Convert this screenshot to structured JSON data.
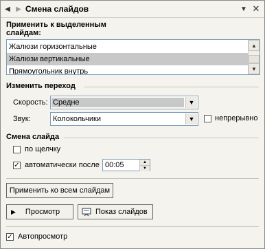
{
  "titlebar": {
    "title": "Смена слайдов",
    "back_icon": "back-arrow-icon",
    "forward_icon": "forward-arrow-icon",
    "dropdown_icon": "chevron-down-icon",
    "close_icon": "close-icon"
  },
  "apply_section": {
    "label_line1": "Применить к выделенным",
    "label_line2": "слайдам:",
    "items": [
      {
        "label": "Жалюзи горизонтальные",
        "selected": false
      },
      {
        "label": "Жалюзи вертикальные",
        "selected": true
      },
      {
        "label": "Прямоугольник внутрь",
        "selected": false
      }
    ]
  },
  "modify_section": {
    "title": "Изменить переход",
    "speed_label": "Скорость:",
    "speed_value": "Средне",
    "sound_label": "Звук:",
    "sound_value": "Колокольчики",
    "loop_label": "непрерывно",
    "loop_checked": false
  },
  "advance_section": {
    "title": "Смена слайда",
    "on_click_label": "по щелчку",
    "on_click_checked": false,
    "auto_label": "автоматически после",
    "auto_checked": true,
    "auto_time": "00:05"
  },
  "buttons": {
    "apply_all": "Применить ко всем слайдам",
    "preview": "Просмотр",
    "slideshow": "Показ слайдов"
  },
  "autopreview": {
    "label": "Автопросмотр",
    "checked": true
  },
  "colors": {
    "panel_bg": "#f4f3ee",
    "selection": "#c8c8c8",
    "border": "#7f9db9"
  }
}
